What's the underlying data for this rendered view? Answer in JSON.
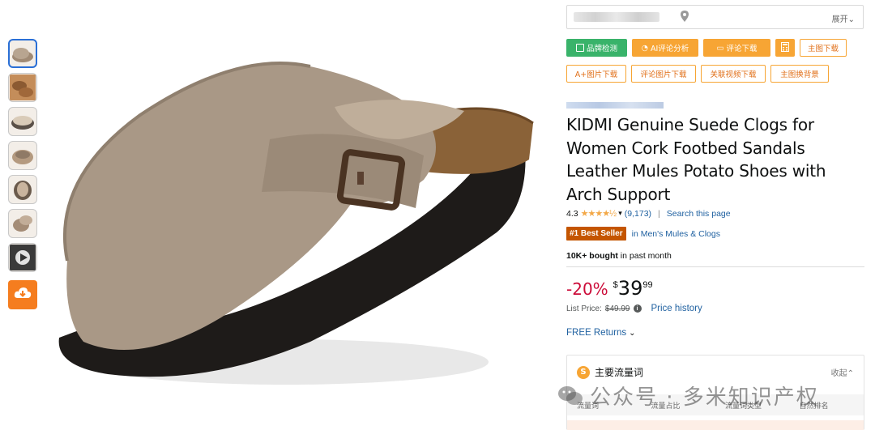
{
  "thumbnails": [
    {
      "name": "thumb-1",
      "active": true
    },
    {
      "name": "thumb-2",
      "active": false
    },
    {
      "name": "thumb-3",
      "active": false
    },
    {
      "name": "thumb-4",
      "active": false
    },
    {
      "name": "thumb-5",
      "active": false
    },
    {
      "name": "thumb-6",
      "active": false
    },
    {
      "name": "thumb-7-video",
      "active": false
    }
  ],
  "download_icon": "cloud-download-icon",
  "location": {
    "expand_label": "展开⌄"
  },
  "plugin_buttons": {
    "brand_check": "品牌检测",
    "ai_review": "AI评论分析",
    "review_download": "评论下载",
    "calc_icon": "calculator-icon",
    "main_image_download": "主图下载",
    "aplus_download": "A+图片下载",
    "review_image_download": "评论图片下载",
    "related_video_download": "关联视频下载",
    "main_image_bg": "主图换背景"
  },
  "product": {
    "title": "KIDMI Genuine Suede Clogs for Women Cork Footbed Sandals Leather Mules Potato Shoes with Arch Support",
    "rating": "4.3",
    "stars": "★★★★½",
    "review_count": "(9,173)",
    "search_page": "Search this page",
    "best_seller_badge": "#1 Best Seller",
    "best_seller_category": "in Men's Mules & Clogs",
    "bought_bold": "10K+ bought",
    "bought_rest": " in past month",
    "discount": "-20%",
    "currency": "$",
    "price_whole": "39",
    "price_fraction": "99",
    "list_price_label": "List Price:",
    "list_price": "$49.99",
    "price_history": "Price history",
    "free_returns": "FREE Returns"
  },
  "traffic": {
    "title": "主要流量词",
    "collapse": "收起⌃",
    "columns": [
      "流量词",
      "流量占比",
      "流量词类型",
      "自然排名"
    ]
  },
  "watermark": "公众号 · 多米知识产权",
  "colors": {
    "green": "#39b36a",
    "orange": "#f7a534",
    "link": "#2162a1",
    "discount": "#cc0c39",
    "best_seller": "#c45500",
    "stars": "#f3a847"
  }
}
